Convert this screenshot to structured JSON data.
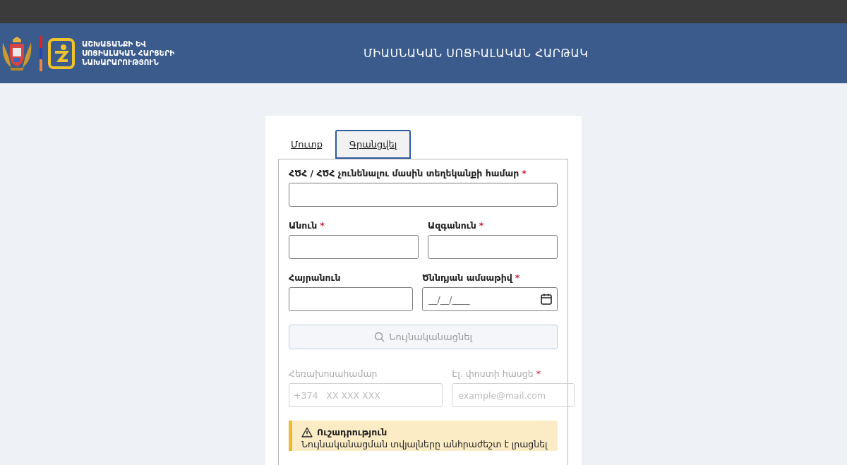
{
  "header": {
    "ministry_lines": [
      "ԱՇԽԱՏԱՆՔԻ ԵՎ",
      "ՍՈՑԻԱԼԱԿԱՆ ՀԱՐՑԵՐԻ",
      "ՆԱԽԱՐԱՐՈՒԹՅՈՒՆ"
    ],
    "title": "ՄԻԱՍՆԱԿԱՆ ՍՈՑԻԱԼԱԿԱՆ ՀԱՐԹԱԿ"
  },
  "tabs": [
    {
      "label": "Մուտք",
      "selected": false
    },
    {
      "label": "Գրանցվել",
      "selected": true
    }
  ],
  "fields": [
    [
      {
        "kind": "text",
        "label": "ՀԾՀ / ՀԾՀ չունենալու մասին տեղեկանքի համար",
        "asterisk": "*"
      }
    ],
    [
      {
        "kind": "text",
        "label": "Անուն",
        "asterisk": "*"
      },
      {
        "kind": "text",
        "label": "Ազգանուն",
        "asterisk": "*"
      }
    ],
    [
      {
        "kind": "text",
        "label": "Հայրանուն"
      },
      {
        "kind": "date",
        "label": "Ծննդյան ամսաթիվ",
        "asterisk": "*",
        "placeholder": "__/__/____"
      }
    ]
  ],
  "verify_button": {
    "label": "Նույնականացնել",
    "disabled": true
  },
  "contact_fields": [
    {
      "kind": "phone",
      "label": "Հեռախոսահամար",
      "prefix": "+374",
      "placeholder": "XX XXX XXX",
      "disabled": true
    },
    {
      "kind": "text",
      "label": "Էլ. փոստի հասցե",
      "asterisk": "*",
      "placeholder": "example@mail.com",
      "disabled": true
    }
  ],
  "warning": {
    "title": "Ուշադրություն",
    "text": "Նույնականացման տվյալները անհրաժեշտ է լրացնել"
  }
}
